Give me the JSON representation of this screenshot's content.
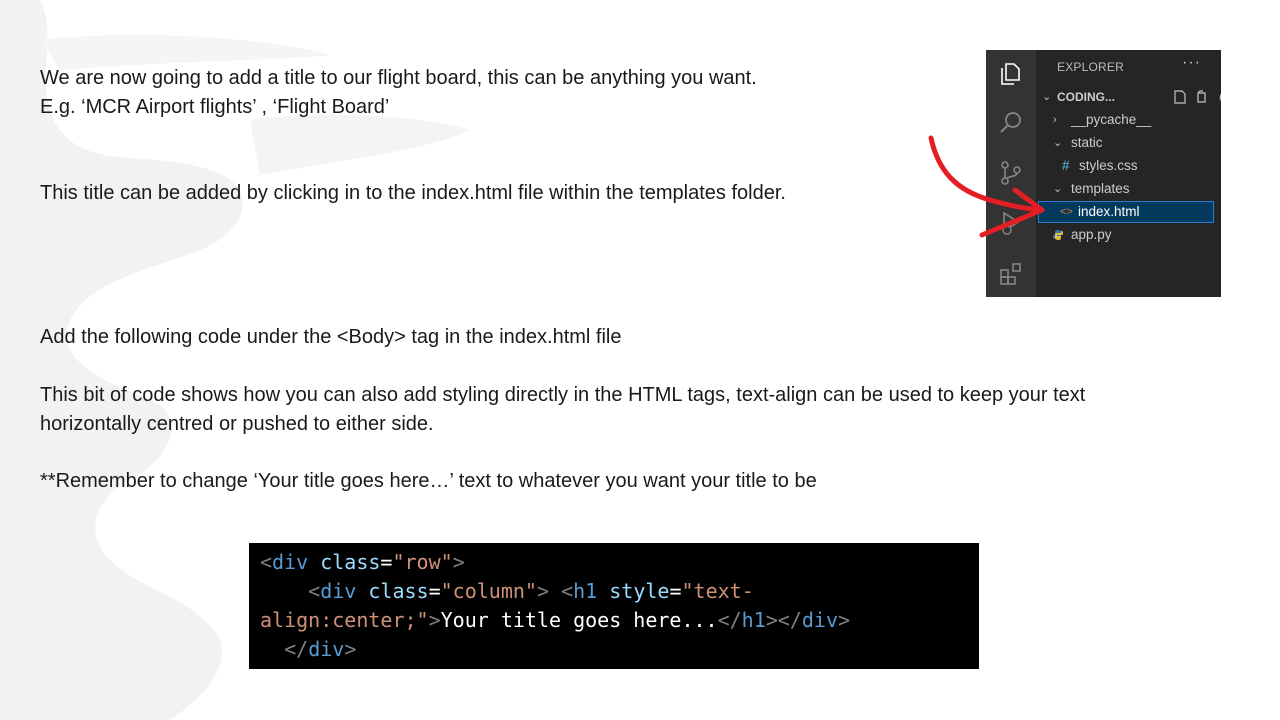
{
  "slide": {
    "para1_line1": "We are now going to add a title to our flight board, this can be anything you want.",
    "para1_line2": "E.g. ‘MCR Airport flights’ , ‘Flight Board’",
    "para2": "This title can be added by clicking in to the index.html file within the templates folder.",
    "para3": "Add the following code under the <Body> tag in the index.html file",
    "para4_line1": "This bit of code shows how you can also add styling directly in the HTML tags, text-align can be used to keep your text",
    "para4_line2": "horizontally centred or pushed to either side.",
    "para5": "**Remember to change ‘Your title goes here…’ text to whatever you want your title to be"
  },
  "explorer": {
    "header": "EXPLORER",
    "more": "···",
    "workspace": "CODING...",
    "items": [
      {
        "label": "__pycache__",
        "chevron": "›"
      },
      {
        "label": "static",
        "chevron": "⌄"
      },
      {
        "label": "styles.css",
        "icon": "#"
      },
      {
        "label": "templates",
        "chevron": "⌄"
      },
      {
        "label": "index.html",
        "icon": "<>"
      },
      {
        "label": "app.py",
        "icon": "python"
      }
    ],
    "selected": "index.html",
    "activity_icons": [
      "files-icon",
      "search-icon",
      "source-control-icon",
      "run-debug-icon",
      "extensions-icon"
    ]
  },
  "code": {
    "l1_open": "<",
    "l1_tag": "div",
    "l1_attr": " class",
    "l1_eq": "=",
    "l1_val": "\"row\"",
    "l1_close": ">",
    "l2_indent": "    ",
    "l2_open": "<",
    "l2_tag": "div",
    "l2_attr": " class",
    "l2_eq": "=",
    "l2_val": "\"column\"",
    "l2_close": "> ",
    "l2_open2": "<",
    "l2_tag2": "h1",
    "l2_attr2": " style",
    "l2_eq2": "=",
    "l2_val2": "\"text-",
    "l3_val": "align:center;\"",
    "l3_close": ">",
    "l3_text": "Your title goes here...",
    "l3_end1": "</",
    "l3_tag1": "h1",
    "l3_gt1": "></",
    "l3_tag2": "div",
    "l3_gt2": ">",
    "l4_indent": "  ",
    "l4_end": "</",
    "l4_tag": "div",
    "l4_gt": ">"
  },
  "colors": {
    "annotation_arrow": "#e31e24",
    "code_background": "#000000",
    "explorer_background": "#252526",
    "selection": "#04395e"
  }
}
